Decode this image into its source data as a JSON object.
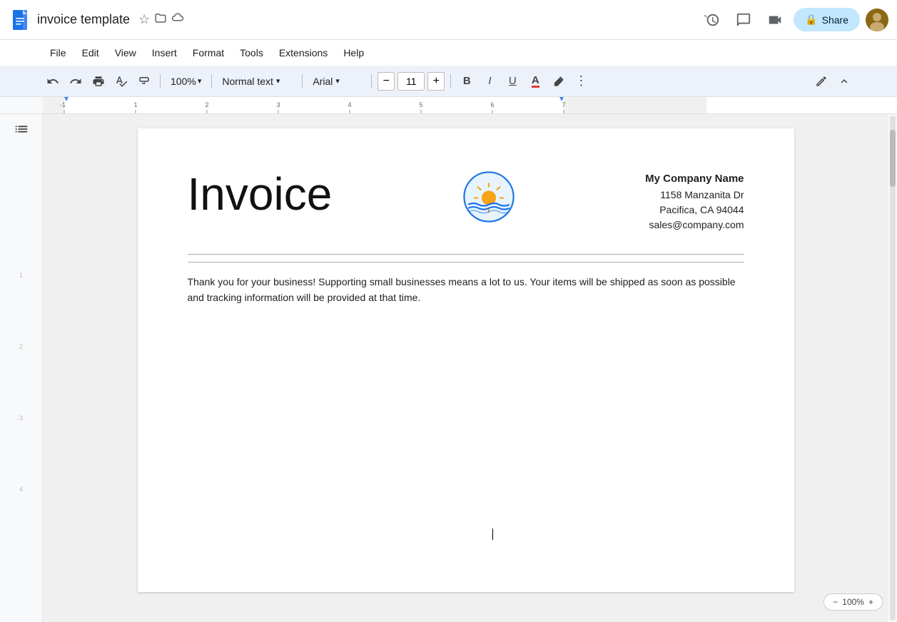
{
  "app": {
    "icon_color": "#1a73e8",
    "title": "invoice template",
    "star_label": "star",
    "folder_label": "folder",
    "cloud_label": "cloud"
  },
  "top_actions": {
    "history_label": "history",
    "comment_label": "comment",
    "meet_label": "meet",
    "meet_dropdown": "meet dropdown",
    "share_label": "Share",
    "share_icon": "🔒"
  },
  "menu": {
    "items": [
      "File",
      "Edit",
      "View",
      "Insert",
      "Format",
      "Tools",
      "Extensions",
      "Help"
    ]
  },
  "toolbar": {
    "undo_label": "↩",
    "redo_label": "↪",
    "print_label": "🖨",
    "spellcheck_label": "abc✓",
    "paintformat_label": "🖌",
    "zoom_value": "100%",
    "zoom_dropdown": "▾",
    "style_value": "Normal text",
    "style_dropdown": "▾",
    "font_value": "Arial",
    "font_dropdown": "▾",
    "font_size_minus": "−",
    "font_size_value": "11",
    "font_size_plus": "+",
    "bold_label": "B",
    "italic_label": "I",
    "underline_label": "U",
    "font_color_label": "A",
    "highlight_label": "✏",
    "more_label": "⋮",
    "pen_label": "✏",
    "collapse_label": "▲"
  },
  "ruler": {
    "marks": [
      "-1",
      "1",
      "2",
      "3",
      "4",
      "5",
      "6",
      "7"
    ]
  },
  "outline": {
    "icon": "☰"
  },
  "document": {
    "invoice_title": "Invoice",
    "company_name": "My Company Name",
    "address_line1": "1158 Manzanita Dr",
    "address_line2": "Pacifica, CA 94044",
    "email": "sales@company.com",
    "thank_you_text": "Thank you for your business! Supporting small businesses means a lot to us. Your items will be shipped as soon as possible and tracking information will be provided at that time."
  }
}
